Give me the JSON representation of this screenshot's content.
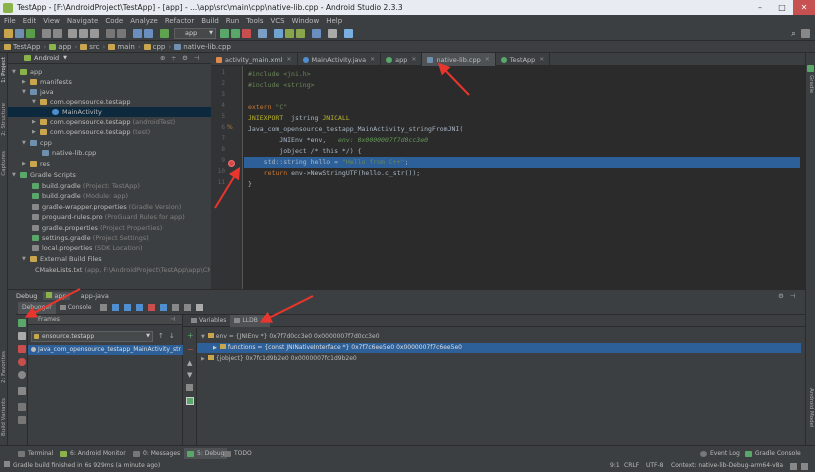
{
  "window": {
    "title": "TestApp - [F:\\AndroidProject\\TestApp] - [app] - ...\\app\\src\\main\\cpp\\native-lib.cpp - Android Studio 2.3.3"
  },
  "menu": [
    "File",
    "Edit",
    "View",
    "Navigate",
    "Code",
    "Analyze",
    "Refactor",
    "Build",
    "Run",
    "Tools",
    "VCS",
    "Window",
    "Help"
  ],
  "toolbar": {
    "run_config": "app"
  },
  "breadcrumbs": [
    "TestApp",
    "app",
    "src",
    "main",
    "cpp",
    "native-lib.cpp"
  ],
  "project": {
    "view_mode": "Android",
    "tree": [
      {
        "label": "app",
        "note": ""
      },
      {
        "label": "manifests",
        "note": ""
      },
      {
        "label": "java",
        "note": ""
      },
      {
        "label": "com.opensource.testapp",
        "note": ""
      },
      {
        "label": "MainActivity",
        "note": ""
      },
      {
        "label": "com.opensource.testapp",
        "note": "(androidTest)"
      },
      {
        "label": "com.opensource.testapp",
        "note": "(test)"
      },
      {
        "label": "cpp",
        "note": ""
      },
      {
        "label": "native-lib.cpp",
        "note": ""
      },
      {
        "label": "res",
        "note": ""
      },
      {
        "label": "Gradle Scripts",
        "note": ""
      },
      {
        "label": "build.gradle",
        "note": "(Project: TestApp)"
      },
      {
        "label": "build.gradle",
        "note": "(Module: app)"
      },
      {
        "label": "gradle-wrapper.properties",
        "note": "(Gradle Version)"
      },
      {
        "label": "proguard-rules.pro",
        "note": "(ProGuard Rules for app)"
      },
      {
        "label": "gradle.properties",
        "note": "(Project Properties)"
      },
      {
        "label": "settings.gradle",
        "note": "(Project Settings)"
      },
      {
        "label": "local.properties",
        "note": "(SDK Location)"
      },
      {
        "label": "External Build Files",
        "note": ""
      },
      {
        "label": "CMakeLists.txt",
        "note": "(app, F:\\AndroidProject\\TestApp\\app\\CM"
      }
    ]
  },
  "editor_tabs": [
    "activity_main.xml",
    "MainActivity.java",
    "app",
    "native-lib.cpp",
    "TestApp"
  ],
  "code": [
    {
      "n": "1",
      "parts": [
        [
          "inc",
          "#include <jni.h>"
        ]
      ]
    },
    {
      "n": "2",
      "parts": [
        [
          "inc",
          "#include <string>"
        ]
      ]
    },
    {
      "n": "3",
      "parts": []
    },
    {
      "n": "4",
      "parts": [
        [
          "kw",
          "extern "
        ],
        [
          "str",
          "\"C\""
        ]
      ]
    },
    {
      "n": "5",
      "parts": [
        [
          "mac",
          "JNIEXPORT"
        ],
        [
          "",
          "  jstring "
        ],
        [
          "mac",
          "JNICALL"
        ]
      ]
    },
    {
      "n": "6",
      "parts": [
        [
          "",
          "Java_com_opensource_testapp_MainActivity_stringFromJNI("
        ]
      ]
    },
    {
      "n": "7",
      "parts": [
        [
          "",
          "        JNIEnv *env,   "
        ],
        [
          "cm",
          "env: 0x0000007f7d0cc3e0"
        ]
      ]
    },
    {
      "n": "8",
      "parts": [
        [
          "",
          "        jobject /* this */) {"
        ]
      ]
    },
    {
      "n": "9",
      "parts": [
        [
          "",
          "    std::string hello = "
        ],
        [
          "str",
          "\"Hello from C++\""
        ],
        [
          "",
          ";"
        ]
      ]
    },
    {
      "n": "10",
      "parts": [
        [
          "",
          "    "
        ],
        [
          "kw",
          "return "
        ],
        [
          "",
          "env->NewStringUTF(hello.c_str());"
        ]
      ]
    },
    {
      "n": "11",
      "parts": [
        [
          "",
          "}"
        ]
      ]
    }
  ],
  "debug": {
    "label": "Debug",
    "tabs": [
      "app",
      "app-java"
    ],
    "subtabs": [
      "Debugger",
      "Console"
    ],
    "frames_label": "Frames",
    "thread": "ensource.testapp",
    "frame": "Java_com_opensource_testapp_MainActivity_str",
    "vars_tabs": [
      "Variables",
      "LLDB"
    ],
    "variables": [
      "env = {JNIEnv *} 0x7f7d0cc3e0 0x0000007f7d0cc3e0",
      "functions = {const JNINativeInterface *} 0x7f7c6ee5e0 0x0000007f7c6ee5e0",
      "{jobject} 0x7fc1d9b2e0 0x0000007fc1d9b2e0"
    ]
  },
  "bottom_tools": [
    "Terminal",
    "6: Android Monitor",
    "0: Messages",
    "5: Debug",
    "TODO",
    "Event Log",
    "Gradle Console"
  ],
  "status": {
    "message": "Gradle build finished in 6s 929ms (a minute ago)",
    "position": "9:1",
    "line_sep": "CRLF",
    "encoding": "UTF-8",
    "context": "Context: native-lib-Debug-arm64-v8a"
  },
  "side_tabs": {
    "left": [
      "1: Project",
      "2: Structure",
      "Captures",
      "Build Variants",
      "2: Favorites"
    ],
    "right": [
      "Gradle",
      "Android Model"
    ]
  },
  "colors": {
    "selection": "#2d6099",
    "arrow": "#e8352e",
    "bg": "#2b2b2b"
  }
}
